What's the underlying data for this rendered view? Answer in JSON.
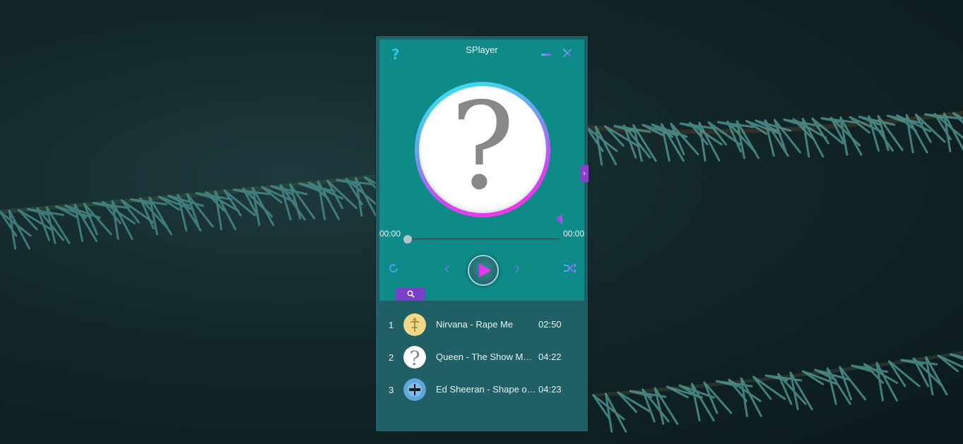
{
  "window": {
    "title": "SPlayer"
  },
  "controls": {
    "current_time": "00:00",
    "total_time": "00:00",
    "progress": 0
  },
  "cover": {
    "placeholder_glyph": "?"
  },
  "playlist": [
    {
      "index": "1",
      "title": "Nirvana - Rape Me",
      "duration": "02:50"
    },
    {
      "index": "2",
      "title": "Queen - The Show Must Go On",
      "duration": "04:22"
    },
    {
      "index": "3",
      "title": "Ed Sheeran - Shape of You",
      "duration": "04:23"
    }
  ],
  "colors": {
    "panel": "#0e8a88",
    "playlist_bg": "#215f66",
    "accent_purple": "#7a3fc8",
    "accent_cyan": "#29c9ea"
  },
  "icons": {
    "help": "help-icon",
    "minimize": "minimize-icon",
    "close": "close-icon",
    "volume": "volume-icon",
    "repeat": "repeat-icon",
    "prev": "chevron-left-icon",
    "play": "play-icon",
    "next": "chevron-right-icon",
    "shuffle": "shuffle-icon",
    "search": "search-icon",
    "expand": "chevron-right-icon"
  }
}
